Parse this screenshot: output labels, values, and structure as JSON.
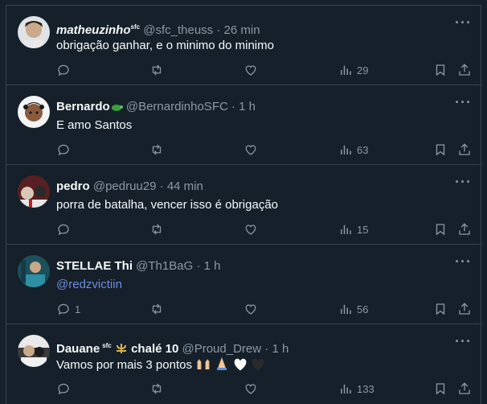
{
  "tweets": [
    {
      "name": "matheuzinho",
      "badge": "sfc",
      "handle": "@sfc_theuss",
      "time": "26 min",
      "text": "obrigação ganhar, e o minimo do minimo",
      "replies": "",
      "retweets": "",
      "likes": "",
      "views": "29",
      "avatar_color": "#c9a98a"
    },
    {
      "name": "Bernardo",
      "badge": "",
      "handle": "@BernardinhoSFC",
      "time": "1 h",
      "text": "E amo Santos",
      "replies": "",
      "retweets": "",
      "likes": "",
      "views": "63",
      "avatar_color": "#f2f2f2"
    },
    {
      "name": "pedro",
      "badge": "",
      "handle": "@pedruu29",
      "time": "44 min",
      "text": "porra de batalha, vencer isso é obrigação",
      "replies": "",
      "retweets": "",
      "likes": "",
      "views": "15",
      "avatar_color": "#7a2b2b"
    },
    {
      "name": "STELLAE Thi",
      "badge": "",
      "handle": "@Th1BaG",
      "time": "1 h",
      "text": "@redzvictiin",
      "replies": "1",
      "retweets": "",
      "likes": "",
      "views": "56",
      "avatar_color": "#2d6a7a"
    },
    {
      "name": "Dauane",
      "badge": "sfc",
      "name_suffix": "chalé 10",
      "handle": "@Proud_Drew",
      "time": "1 h",
      "text": "Vamos por mais 3 pontos",
      "replies": "",
      "retweets": "",
      "likes": "",
      "views": "133",
      "avatar_color": "#3a3a3a"
    }
  ],
  "separator": "·",
  "colors": {
    "background": "#15202b",
    "border": "#38444d",
    "secondary_text": "#8b98a5",
    "link": "#6e8ddc"
  }
}
